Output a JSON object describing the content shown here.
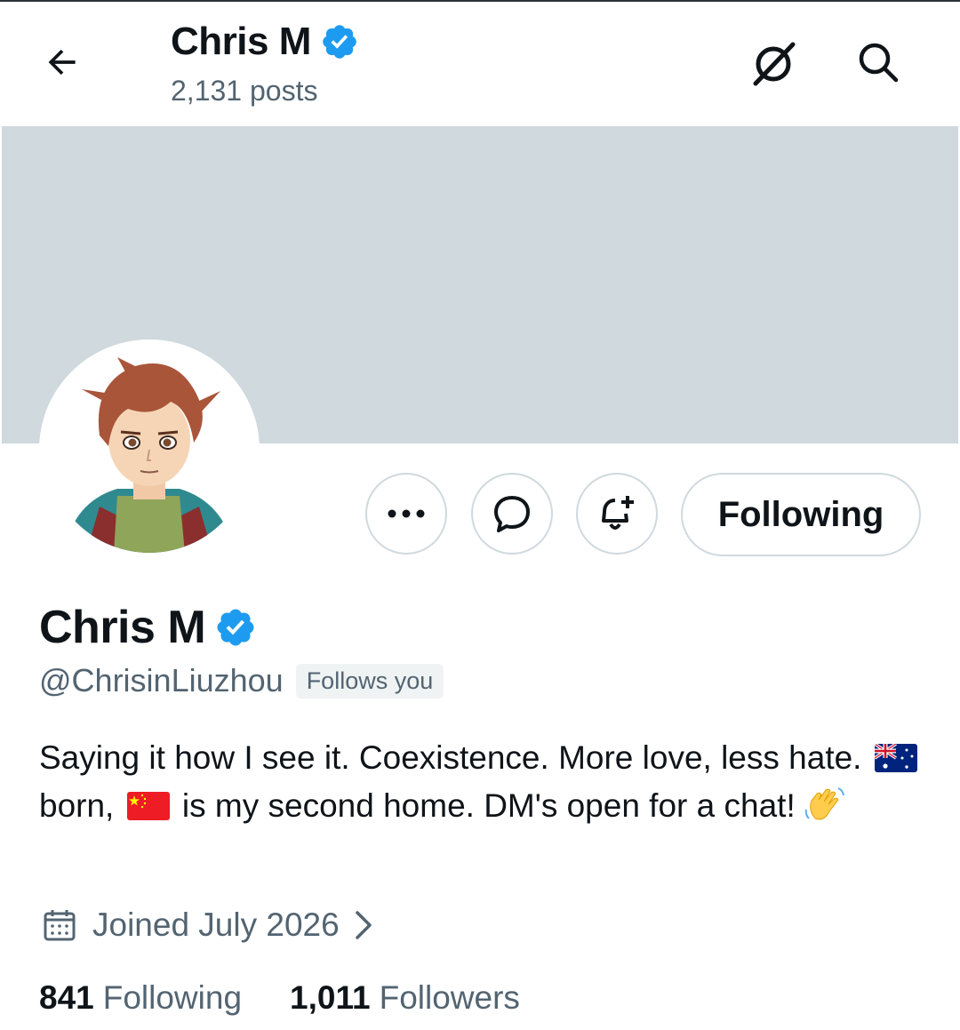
{
  "header": {
    "name": "Chris M",
    "posts": "2,131 posts"
  },
  "actions": {
    "following_label": "Following"
  },
  "profile": {
    "name": "Chris M",
    "handle": "@ChrisinLiuzhou",
    "follows_you": "Follows you",
    "bio_1": "Saying it how I see it. Coexistence. More love, less hate.",
    "bio_2": "born,",
    "bio_3": "is my second home. DM's open for a chat!",
    "joined": "Joined July 2026",
    "following_count": "841",
    "following_label": "Following",
    "followers_count": "1,011",
    "followers_label": "Followers"
  },
  "icons": {
    "back": "arrow-left-icon",
    "grok": "grok-icon",
    "search": "search-icon",
    "more": "more-icon",
    "message": "message-icon",
    "notify": "bell-plus-icon",
    "verified": "verified-badge-icon",
    "calendar": "calendar-icon",
    "chevron": "chevron-right-icon"
  },
  "colors": {
    "accent": "#1d9bf0",
    "banner": "#cfd9de",
    "secondary_text": "#536471",
    "primary_text": "#0f1419"
  }
}
